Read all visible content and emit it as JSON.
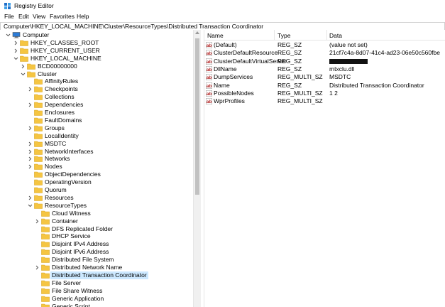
{
  "window": {
    "title": "Registry Editor"
  },
  "menu": [
    "File",
    "Edit",
    "View",
    "Favorites",
    "Help"
  ],
  "address": "Computer\\HKEY_LOCAL_MACHINE\\Cluster\\ResourceTypes\\Distributed Transaction Coordinator",
  "tree": [
    {
      "label": "Computer",
      "level": 0,
      "chevron": "down",
      "icon": "computer"
    },
    {
      "label": "HKEY_CLASSES_ROOT",
      "level": 1,
      "chevron": "right",
      "icon": "folder"
    },
    {
      "label": "HKEY_CURRENT_USER",
      "level": 1,
      "chevron": "right",
      "icon": "folder"
    },
    {
      "label": "HKEY_LOCAL_MACHINE",
      "level": 1,
      "chevron": "down",
      "icon": "folder"
    },
    {
      "label": "BCD00000000",
      "level": 2,
      "chevron": "right",
      "icon": "folder"
    },
    {
      "label": "Cluster",
      "level": 2,
      "chevron": "down",
      "icon": "folder"
    },
    {
      "label": "AffinityRules",
      "level": 3,
      "chevron": "",
      "icon": "folder"
    },
    {
      "label": "Checkpoints",
      "level": 3,
      "chevron": "right",
      "icon": "folder"
    },
    {
      "label": "Collections",
      "level": 3,
      "chevron": "",
      "icon": "folder"
    },
    {
      "label": "Dependencies",
      "level": 3,
      "chevron": "right",
      "icon": "folder"
    },
    {
      "label": "Enclosures",
      "level": 3,
      "chevron": "",
      "icon": "folder"
    },
    {
      "label": "FaultDomains",
      "level": 3,
      "chevron": "",
      "icon": "folder"
    },
    {
      "label": "Groups",
      "level": 3,
      "chevron": "right",
      "icon": "folder"
    },
    {
      "label": "LocalIdentity",
      "level": 3,
      "chevron": "",
      "icon": "folder"
    },
    {
      "label": "MSDTC",
      "level": 3,
      "chevron": "right",
      "icon": "folder"
    },
    {
      "label": "NetworkInterfaces",
      "level": 3,
      "chevron": "right",
      "icon": "folder"
    },
    {
      "label": "Networks",
      "level": 3,
      "chevron": "right",
      "icon": "folder"
    },
    {
      "label": "Nodes",
      "level": 3,
      "chevron": "right",
      "icon": "folder"
    },
    {
      "label": "ObjectDependencies",
      "level": 3,
      "chevron": "",
      "icon": "folder"
    },
    {
      "label": "OperatingVersion",
      "level": 3,
      "chevron": "",
      "icon": "folder"
    },
    {
      "label": "Quorum",
      "level": 3,
      "chevron": "",
      "icon": "folder"
    },
    {
      "label": "Resources",
      "level": 3,
      "chevron": "right",
      "icon": "folder"
    },
    {
      "label": "ResourceTypes",
      "level": 3,
      "chevron": "down",
      "icon": "folder"
    },
    {
      "label": "Cloud Witness",
      "level": 4,
      "chevron": "",
      "icon": "folder"
    },
    {
      "label": "Container",
      "level": 4,
      "chevron": "right",
      "icon": "folder"
    },
    {
      "label": "DFS Replicated Folder",
      "level": 4,
      "chevron": "",
      "icon": "folder"
    },
    {
      "label": "DHCP Service",
      "level": 4,
      "chevron": "",
      "icon": "folder"
    },
    {
      "label": "Disjoint IPv4 Address",
      "level": 4,
      "chevron": "",
      "icon": "folder"
    },
    {
      "label": "Disjoint IPv6 Address",
      "level": 4,
      "chevron": "",
      "icon": "folder"
    },
    {
      "label": "Distributed File System",
      "level": 4,
      "chevron": "",
      "icon": "folder"
    },
    {
      "label": "Distributed Network Name",
      "level": 4,
      "chevron": "right",
      "icon": "folder"
    },
    {
      "label": "Distributed Transaction Coordinator",
      "level": 4,
      "chevron": "",
      "icon": "folder",
      "selected": true
    },
    {
      "label": "File Server",
      "level": 4,
      "chevron": "",
      "icon": "folder"
    },
    {
      "label": "File Share Witness",
      "level": 4,
      "chevron": "",
      "icon": "folder"
    },
    {
      "label": "Generic Application",
      "level": 4,
      "chevron": "",
      "icon": "folder"
    },
    {
      "label": "Generic Script",
      "level": 4,
      "chevron": "",
      "icon": "folder"
    }
  ],
  "values": {
    "columns": {
      "name": "Name",
      "type": "Type",
      "data": "Data"
    },
    "rows": [
      {
        "icon": "string",
        "name": "(Default)",
        "type": "REG_SZ",
        "data": "(value not set)"
      },
      {
        "icon": "string",
        "name": "ClusterDefaultResource",
        "type": "REG_SZ",
        "data": "21cf7c4a-8d07-41c4-ad23-06e50c560fbe"
      },
      {
        "icon": "string",
        "name": "ClusterDefaultVirtualServer",
        "type": "REG_SZ",
        "data": "",
        "redacted": true
      },
      {
        "icon": "string",
        "name": "DllName",
        "type": "REG_SZ",
        "data": "mtxclu.dll"
      },
      {
        "icon": "string",
        "name": "DumpServices",
        "type": "REG_MULTI_SZ",
        "data": "MSDTC"
      },
      {
        "icon": "string",
        "name": "Name",
        "type": "REG_SZ",
        "data": "Distributed Transaction Coordinator"
      },
      {
        "icon": "string",
        "name": "PossibleNodes",
        "type": "REG_MULTI_SZ",
        "data": "1 2"
      },
      {
        "icon": "string",
        "name": "WprProfiles",
        "type": "REG_MULTI_SZ",
        "data": ""
      }
    ]
  },
  "colors": {
    "folder": "#f5c542",
    "selection": "#cce8ff",
    "string_icon": "#b22222",
    "computer": "#2b7bd6"
  }
}
